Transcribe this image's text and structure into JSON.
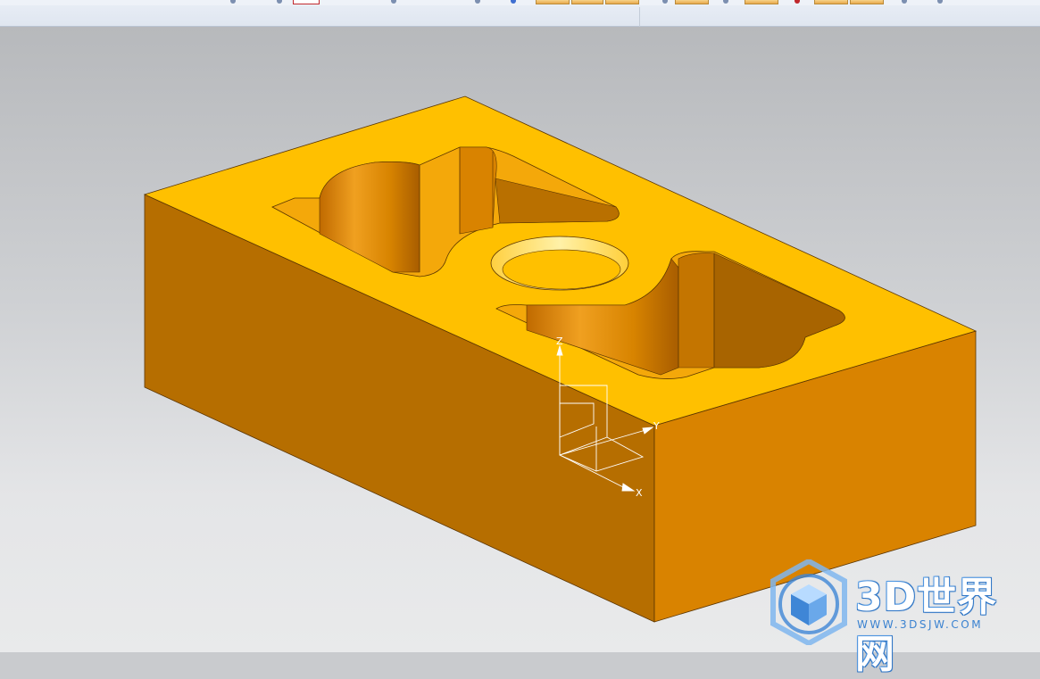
{
  "toolbar": {
    "buttons": [
      "toolbar-button-1",
      "toolbar-button-2",
      "toolbar-button-3",
      "toolbar-button-4",
      "toolbar-button-5",
      "toolbar-button-6",
      "toolbar-button-7"
    ]
  },
  "viewport": {
    "background_top": "#b7b9bc",
    "background_bottom": "#e9eaeb"
  },
  "model": {
    "part_color_top": "#ffc000",
    "part_color_front": "#d98300",
    "part_color_side": "#b66e00",
    "pocket_wall_color": "#d98300",
    "bore_color": "#ffe27a"
  },
  "wcs": {
    "x_label": "X",
    "y_label": "Y",
    "z_label": "Z",
    "color": "#ffffff"
  },
  "watermark": {
    "title": "3D世界网",
    "url": "WWW.3DSJW.COM",
    "accent": "#3f86d6"
  }
}
